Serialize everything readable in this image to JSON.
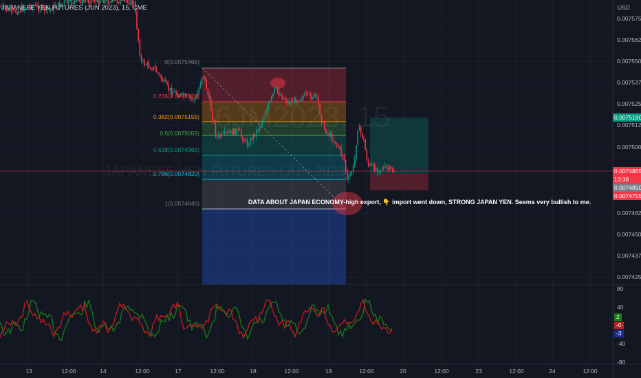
{
  "header": {
    "title": "JAPANESE YEN FUTURES (JUN 2023), 15, CME"
  },
  "watermark": {
    "symbol": "6JM2023, 15",
    "name": "JAPANESE YEN FUTURES (JUN 2023)"
  },
  "price_axis": {
    "currency": "USD",
    "ticks": [
      "0.0075750",
      "0.0075625",
      "0.0075500",
      "0.0075375",
      "0.0075250",
      "0.0075125",
      "0.0075000",
      "0.0074625",
      "0.0074500",
      "0.0074375",
      "0.0074250"
    ]
  },
  "price_tags": [
    {
      "name": "target-price-tag",
      "value": "0.0075180",
      "color": "#089981"
    },
    {
      "name": "last-price-tag",
      "value": "0.0074865",
      "color": "#f23645"
    },
    {
      "name": "countdown-tag",
      "value": "13:38",
      "color": "#f23645"
    },
    {
      "name": "crosshair-price-tag",
      "value": "0.0074850",
      "color": "#787b86"
    },
    {
      "name": "stop-price-tag",
      "value": "0.0074755",
      "color": "#f23645"
    }
  ],
  "fib_levels": [
    {
      "label": "0(0.0075465)",
      "color": "#787b86"
    },
    {
      "label": "0.236(0.0075328)",
      "color": "#f23645"
    },
    {
      "label": "0.382(0.0075155)",
      "color": "#ff9800"
    },
    {
      "label": "0.5(0.0075055)",
      "color": "#4caf50"
    },
    {
      "label": "0.618(0.0074960)",
      "color": "#089981"
    },
    {
      "label": "0.786(0.0074820)",
      "color": "#00bcd4"
    },
    {
      "label": "1(0.0074645)",
      "color": "#787b86"
    }
  ],
  "annotation": {
    "text_part1": "DATA ABOUT JAPAN ECONOMY-high export,",
    "emoji": "👇",
    "text_part2": "import went down, STRONG JAPAN YEN. Seems very bullish to me."
  },
  "oscillator": {
    "axis_ticks": [
      "80",
      "40",
      "-40",
      "-80"
    ],
    "tags": [
      {
        "name": "osc-value-green",
        "value": "2",
        "color": "#1b7a1b"
      },
      {
        "name": "osc-value-red",
        "value": "-0",
        "color": "#b22222"
      },
      {
        "name": "osc-value-blue",
        "value": "-3",
        "color": "#1c2a8c"
      }
    ]
  },
  "time_axis": {
    "ticks": [
      "13",
      "12:00",
      "14",
      "12:00",
      "17",
      "12:00",
      "18",
      "12:00",
      "19",
      "12:00",
      "20",
      "12:00",
      "23",
      "12:00",
      "24",
      "12:00"
    ]
  },
  "colors": {
    "background": "#131722",
    "up": "#089981",
    "down": "#f23645",
    "grid": "#1e222d"
  }
}
